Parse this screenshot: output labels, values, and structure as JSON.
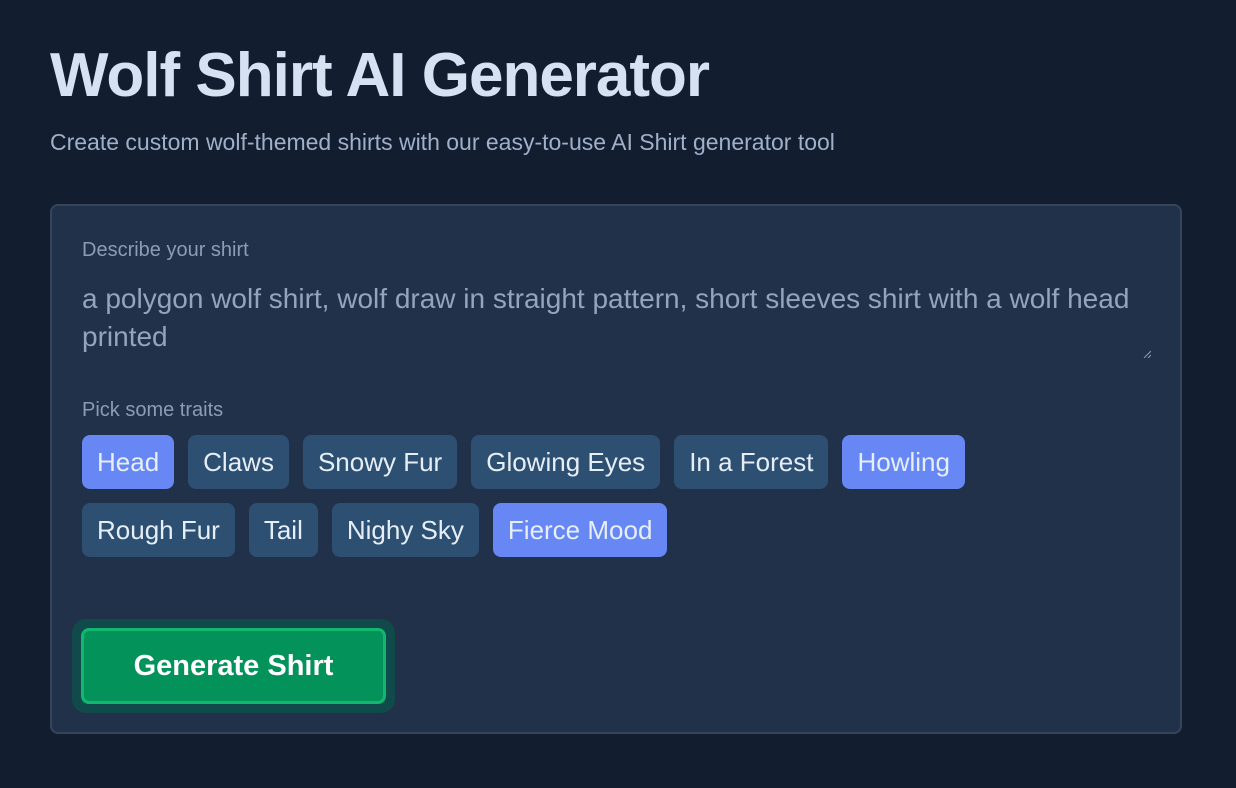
{
  "header": {
    "title": "Wolf Shirt AI Generator",
    "subtitle": "Create custom wolf-themed shirts with our easy-to-use AI Shirt generator tool"
  },
  "form": {
    "description_label": "Describe your shirt",
    "description_value": "a polygon wolf shirt, wolf draw in straight pattern, short sleeves shirt with a wolf head printed",
    "traits_label": "Pick some traits",
    "traits": [
      {
        "label": "Head",
        "selected": true
      },
      {
        "label": "Claws",
        "selected": false
      },
      {
        "label": "Snowy Fur",
        "selected": false
      },
      {
        "label": "Glowing Eyes",
        "selected": false
      },
      {
        "label": "In a Forest",
        "selected": false
      },
      {
        "label": "Howling",
        "selected": true
      },
      {
        "label": "Rough Fur",
        "selected": false
      },
      {
        "label": "Tail",
        "selected": false
      },
      {
        "label": "Nighy Sky",
        "selected": false
      },
      {
        "label": "Fierce Mood",
        "selected": true
      }
    ],
    "generate_label": "Generate Shirt"
  },
  "colors": {
    "background": "#131d30",
    "card": "#22314a",
    "chip": "#2d4f72",
    "chip_selected": "#6687f4",
    "button": "#02925a",
    "button_border": "#10b86f"
  }
}
